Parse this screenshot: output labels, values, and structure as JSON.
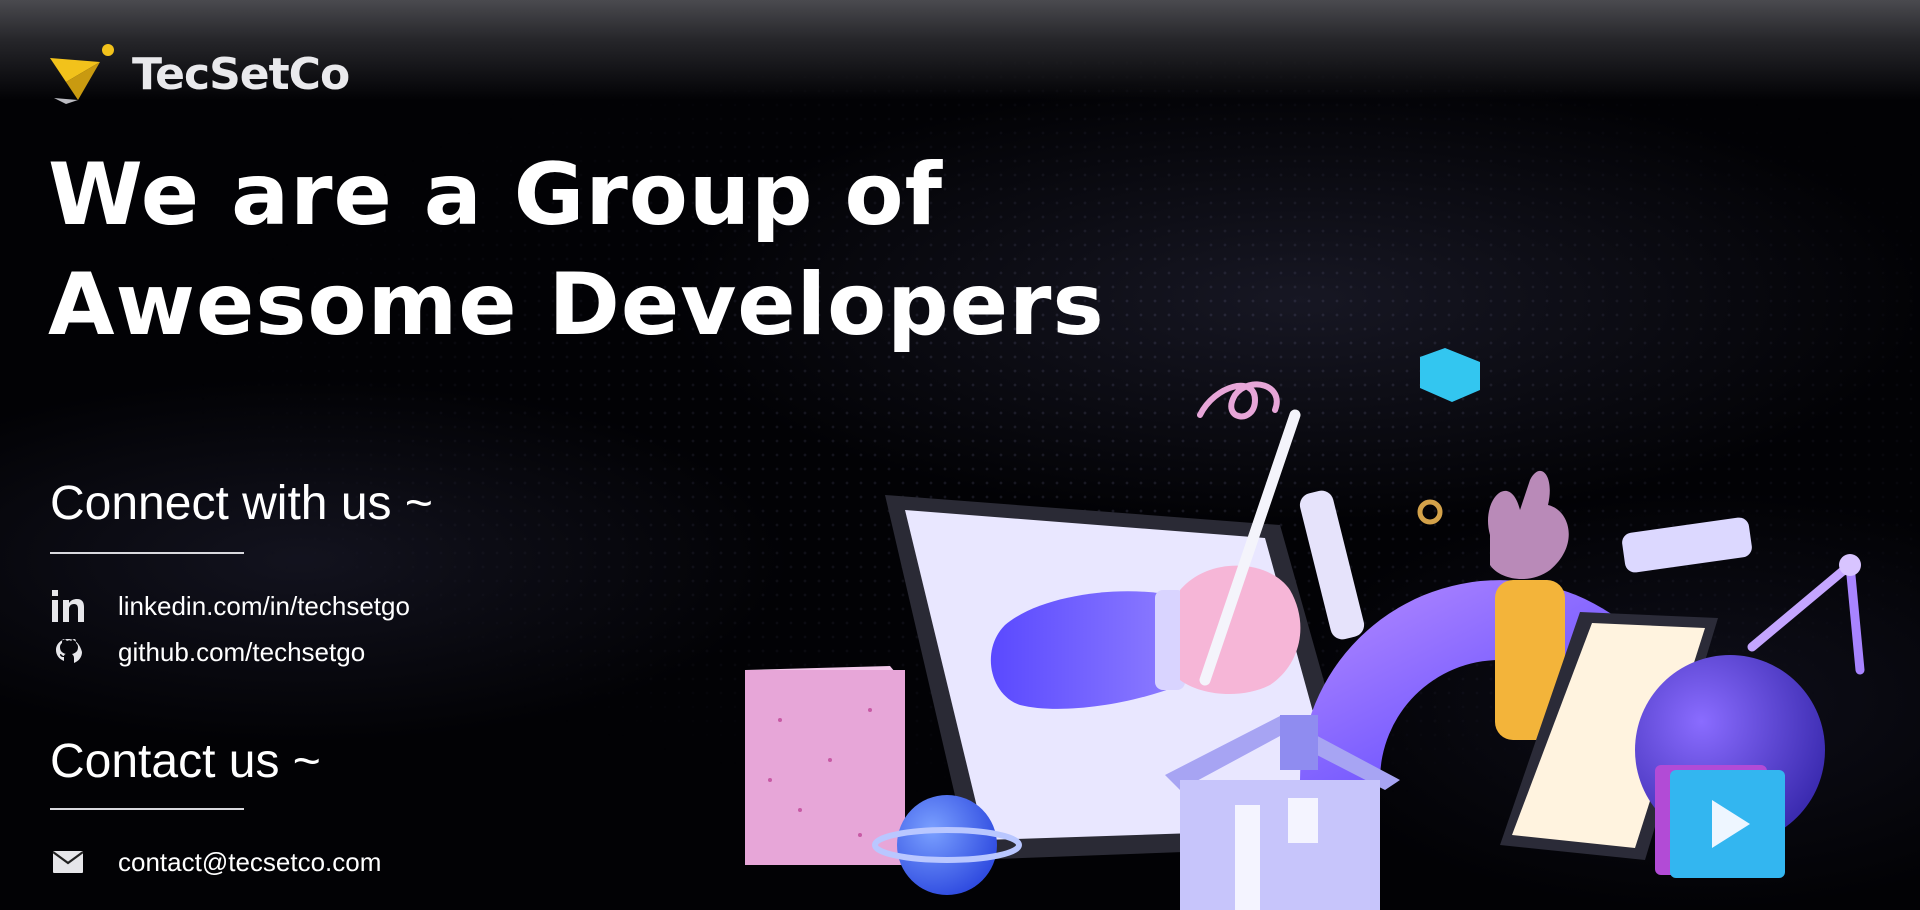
{
  "brand": {
    "name": "TecSetCo"
  },
  "hero": {
    "line1": "We are a Group of",
    "line2": "Awesome Developers"
  },
  "connect": {
    "title": "Connect with us ~",
    "links": [
      {
        "icon": "linkedin-icon",
        "text": "linkedin.com/in/techsetgo"
      },
      {
        "icon": "github-icon",
        "text": "github.com/techsetgo"
      }
    ]
  },
  "contact": {
    "title": "Contact us ~",
    "links": [
      {
        "icon": "mail-icon",
        "text": "contact@tecsetco.com"
      }
    ]
  },
  "colors": {
    "background": "#000000",
    "logo_yellow": "#f2c21b",
    "accent_purple": "#6a4cff",
    "accent_pink": "#e7a6d8",
    "accent_cyan": "#33c6f0"
  }
}
